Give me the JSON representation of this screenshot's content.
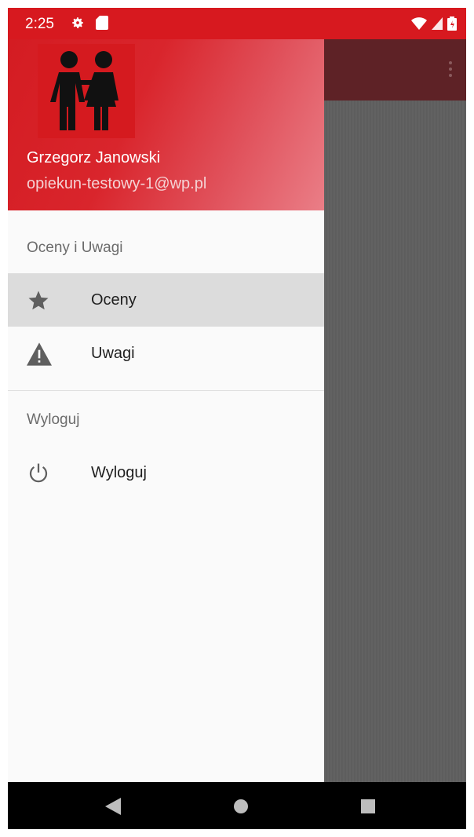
{
  "status_bar": {
    "time": "2:25",
    "color": "#d7191f",
    "icons": [
      "gear-icon",
      "sd-card-icon",
      "wifi-icon",
      "signal-icon",
      "battery-icon"
    ]
  },
  "drawer": {
    "header": {
      "avatar_icon": "couple-icon",
      "user_name": "Grzegorz Janowski",
      "user_email": "opiekun-testowy-1@wp.pl",
      "color": "#d41c22"
    },
    "sections": [
      {
        "title": "Oceny i Uwagi",
        "items": [
          {
            "label": "Oceny",
            "icon": "star-icon",
            "selected": true
          },
          {
            "label": "Uwagi",
            "icon": "warning-icon",
            "selected": false
          }
        ]
      },
      {
        "title": "Wyloguj",
        "items": [
          {
            "label": "Wyloguj",
            "icon": "power-icon",
            "selected": false
          }
        ]
      }
    ]
  },
  "background_app": {
    "toolbar_color": "#5e2226",
    "menu_icon": "overflow-menu-icon"
  },
  "nav_bar": {
    "buttons": [
      "back-icon",
      "home-icon",
      "recents-icon"
    ]
  }
}
